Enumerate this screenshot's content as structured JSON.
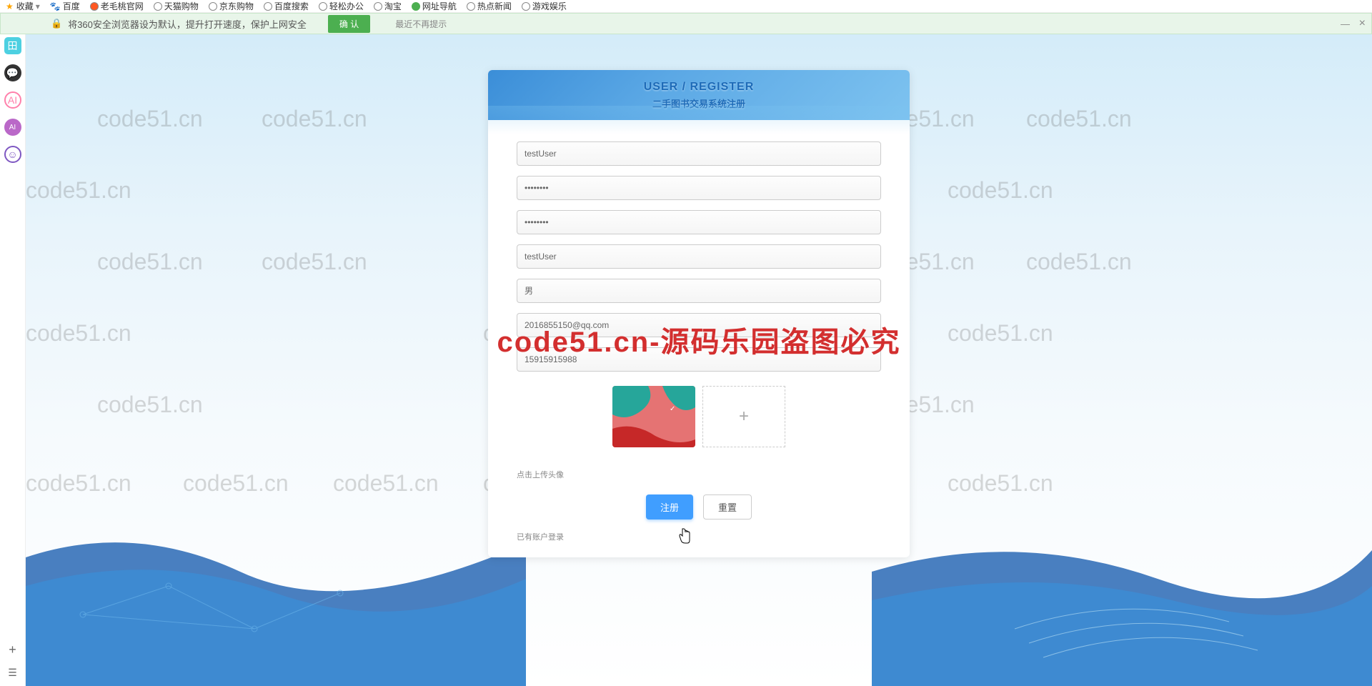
{
  "bookmarks": {
    "fav_label": "收藏",
    "items": [
      "百度",
      "老毛桃官网",
      "天猫购物",
      "京东购物",
      "百度搜索",
      "轻松办公",
      "淘宝",
      "网址导航",
      "热点新闻",
      "游戏娱乐"
    ]
  },
  "notif": {
    "message": "将360安全浏览器设为默认，提升打开速度，保护上网安全",
    "confirm": "确 认",
    "noshow": "最近不再提示"
  },
  "register": {
    "title_en": "USER / REGISTER",
    "title_cn": "二手图书交易系统注册",
    "username": "testUser",
    "password": "········",
    "password2": "········",
    "nickname": "testUser",
    "gender": "男",
    "email": "2016855150@qq.com",
    "phone": "15915915988",
    "upload_hint": "点击上传头像",
    "btn_register": "注册",
    "btn_reset": "重置",
    "login_link": "已有账户登录"
  },
  "watermark": {
    "text": "code51.cn",
    "red_text": "code51.cn-源码乐园盗图必究"
  }
}
